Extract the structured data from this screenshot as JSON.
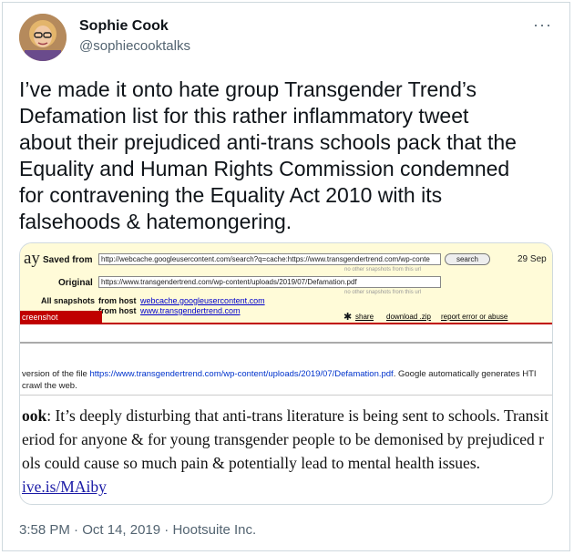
{
  "tweet": {
    "display_name": "Sophie Cook",
    "handle": "@sophiecooktalks",
    "more_icon": "more-horizontal-icon",
    "text_lines": [
      "I’ve made it onto hate group Transgender Trend’s",
      "Defamation list for this rather inflammatory tweet",
      "about their prejudiced anti-trans schools pack that the",
      "Equality and Human Rights Commission condemned",
      "for contravening the Equality Act 2010 with its",
      "falsehoods & hatemongering."
    ],
    "time": "3:58 PM",
    "date": "Oct 14, 2019",
    "source": "Hootsuite Inc.",
    "separator": "·"
  },
  "archive": {
    "logo_fragment": "ay",
    "saved_from_label": "Saved from",
    "saved_from_value": "http://webcache.googleusercontent.com/search?q=cache:https://www.transgendertrend.com/wp-conte",
    "search_button": "search",
    "date_fragment": "29 Sep",
    "no_snapshots_note": "no other snapshots from this url",
    "original_label": "Original",
    "original_value": "https://www.transgendertrend.com/wp-content/uploads/2019/07/Defamation.pdf",
    "all_snapshots_label": "All snapshots",
    "from_host_label": "from host",
    "host_1": "webcache.googleusercontent.com",
    "host_2": "www.transgendertrend.com",
    "tab_label": "creenshot",
    "share": "share",
    "download": "download .zip",
    "report": "report error or abuse"
  },
  "cache": {
    "line1_prefix": "version of the file ",
    "line1_url": "https://www.transgendertrend.com/wp-content/uploads/2019/07/Defamation.pdf",
    "line1_suffix": ". Google automatically generates HTI",
    "line2": "crawl the web."
  },
  "article": {
    "line1_bold": "ook",
    "line1_rest": ": It’s deeply disturbing that anti-trans literature is being sent to schools. Transit",
    "line2": "eriod for anyone & for young transgender people to be demonised by prejudiced r",
    "line3": "ols could cause so much pain & potentially lead to mental health issues.",
    "line4_link": "ive.is/MAiby"
  }
}
